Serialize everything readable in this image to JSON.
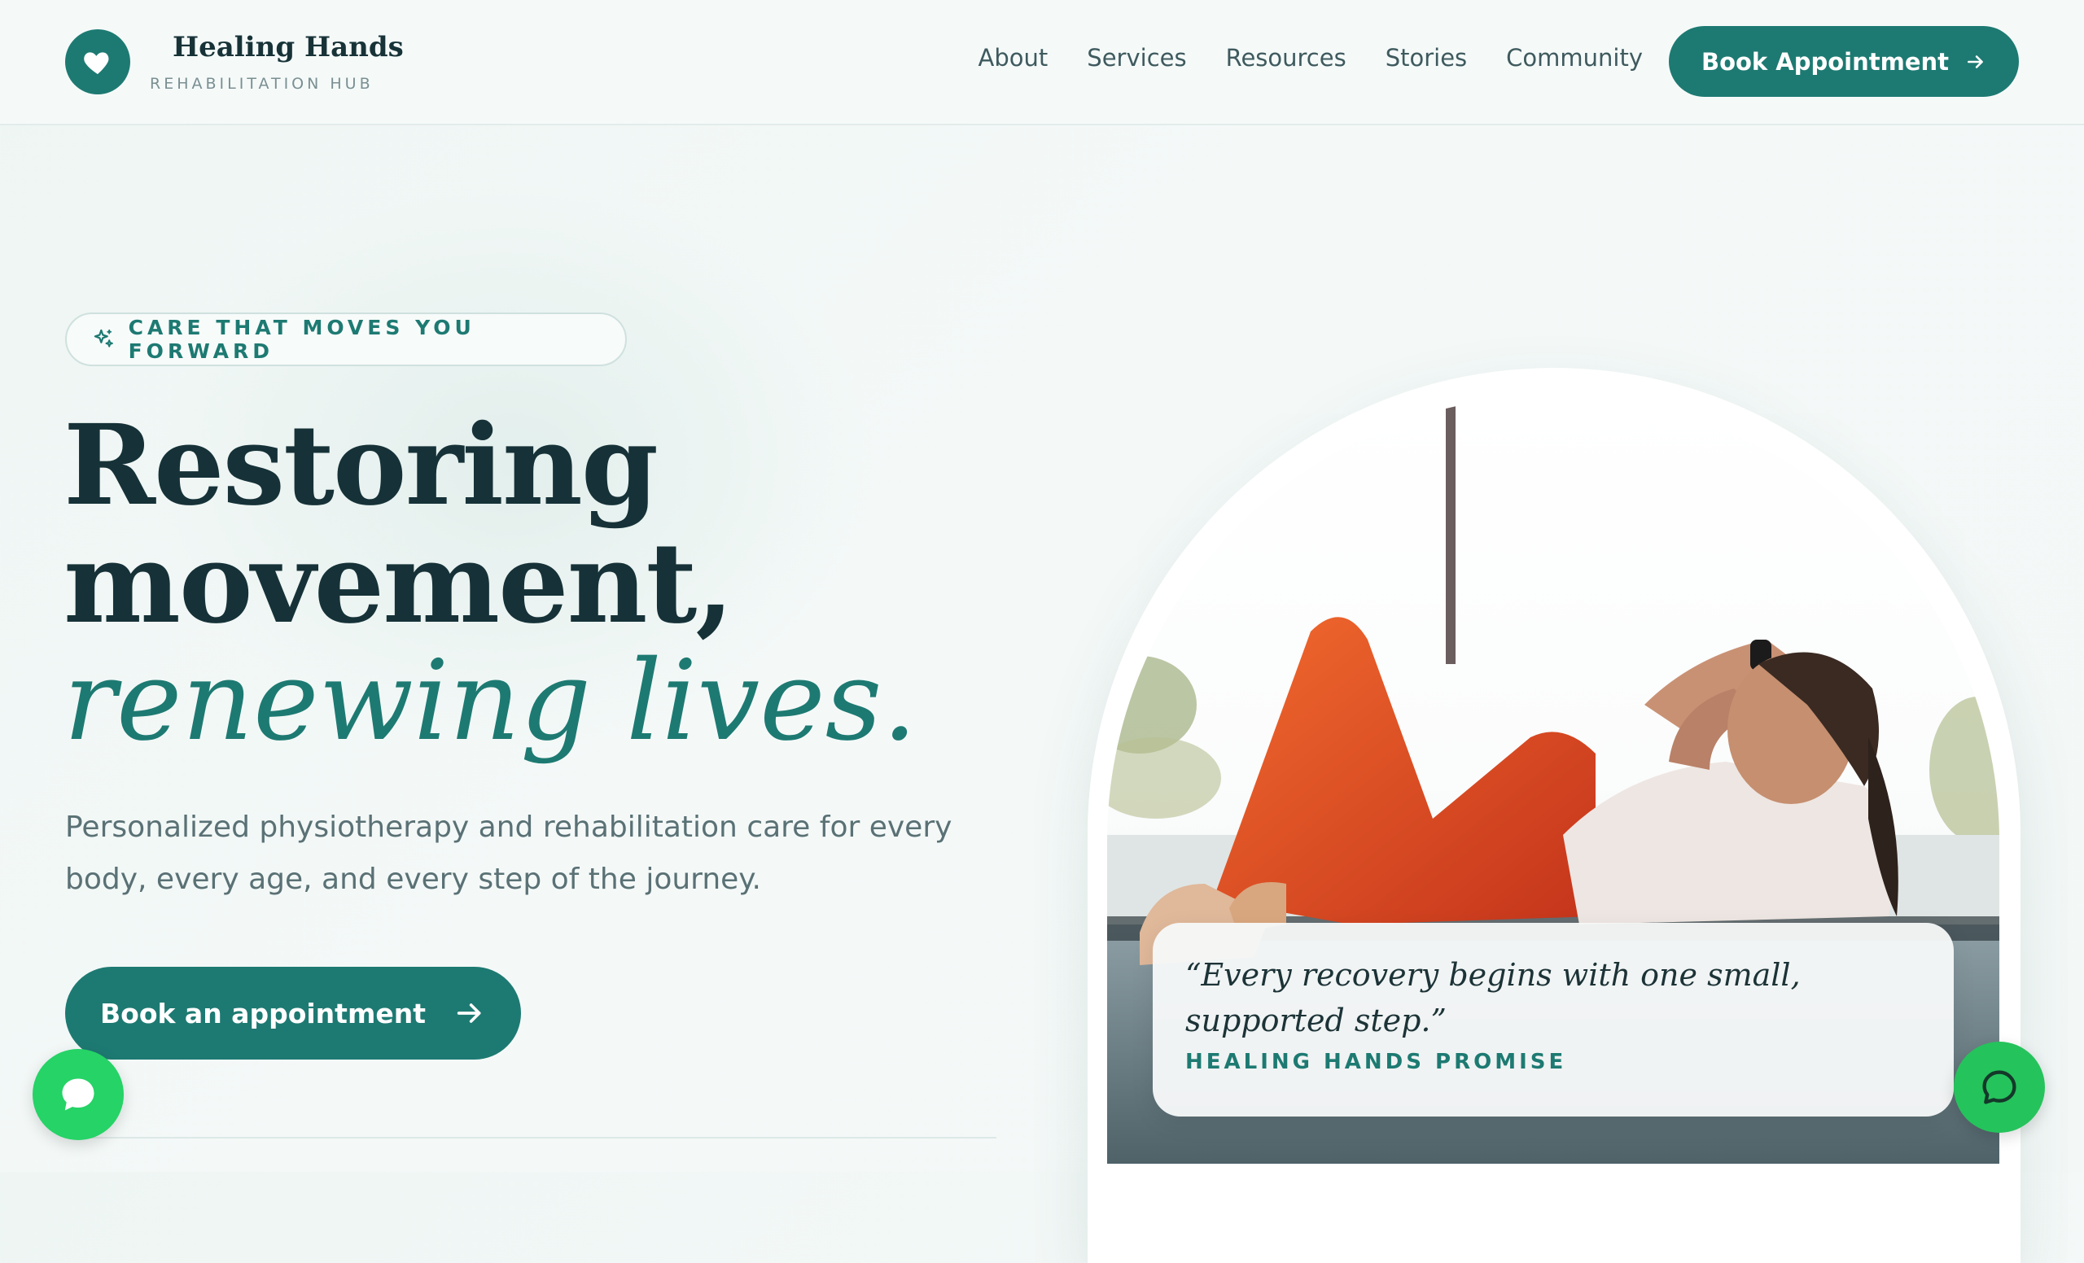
{
  "brand": {
    "name": "Healing Hands",
    "tagline": "REHABILITATION HUB"
  },
  "nav": {
    "items": [
      {
        "label": "About"
      },
      {
        "label": "Services"
      },
      {
        "label": "Resources"
      },
      {
        "label": "Stories"
      },
      {
        "label": "Community"
      }
    ],
    "cta_label": "Book Appointment"
  },
  "hero": {
    "eyebrow": "CARE THAT MOVES YOU FORWARD",
    "headline_line1": "Restoring",
    "headline_line2": "movement,",
    "headline_accent": "renewing lives.",
    "lead": "Personalized physiotherapy and rehabilitation care for every body, every age, and every step of the journey.",
    "cta_label": "Book an appointment"
  },
  "quote": {
    "text": "“Every recovery begins with one small, supported step.”",
    "attribution": "HEALING HANDS PROMISE"
  },
  "colors": {
    "accent": "#1d7a72",
    "heading": "#163238",
    "chat_green": "#25d366"
  },
  "icons": {
    "logo": "heart-icon",
    "eyebrow": "sparkle-icon",
    "cta": "arrow-right-icon",
    "chat": "chat-bubble-icon"
  }
}
